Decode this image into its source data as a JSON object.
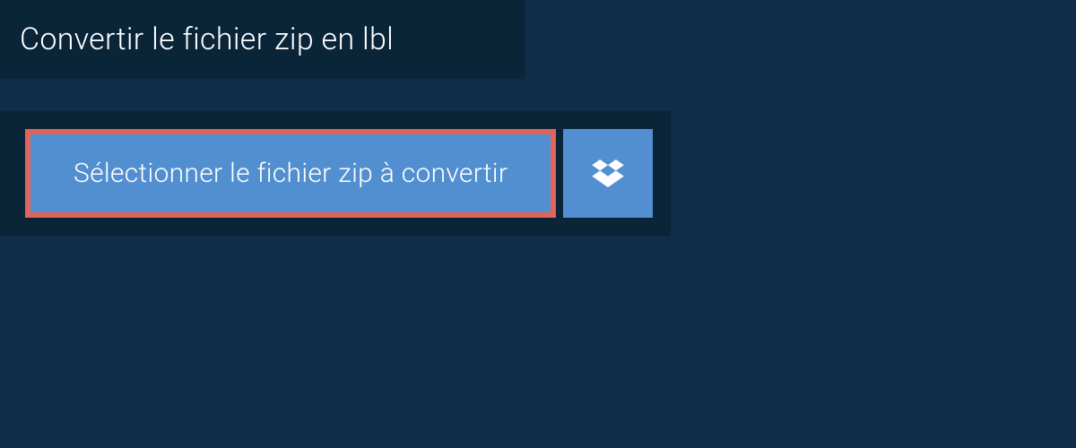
{
  "title": "Convertir le fichier zip en lbl",
  "buttons": {
    "select_file_label": "Sélectionner le fichier zip à convertir"
  },
  "colors": {
    "background": "#0f2d47",
    "panel": "#0a2438",
    "button": "#528fd0",
    "highlight_border": "#e06457"
  }
}
